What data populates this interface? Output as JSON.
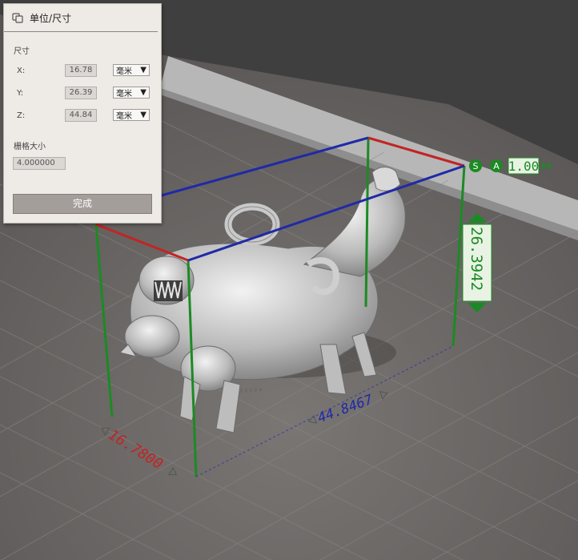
{
  "panel": {
    "title": "单位/尺寸",
    "icon": "units-icon",
    "size_section": "尺寸",
    "x_label": "X:",
    "x_value": "16.78",
    "x_unit": "毫米",
    "y_label": "Y:",
    "y_value": "26.39",
    "y_unit": "毫米",
    "z_label": "Z:",
    "z_value": "44.84",
    "z_unit": "毫米",
    "grid_section": "栅格大小",
    "grid_value": "4.000000",
    "done_label": "完成"
  },
  "viewport": {
    "scale_s_icon": "S",
    "scale_a_icon": "A",
    "scale_value": "1.00",
    "dim_red": "16.7800",
    "dim_blue": "44.8467",
    "dim_green": "26.3942"
  },
  "colors": {
    "x_axis": "#c22424",
    "y_axis": "#1f2aa6",
    "z_axis": "#1c8a24"
  }
}
